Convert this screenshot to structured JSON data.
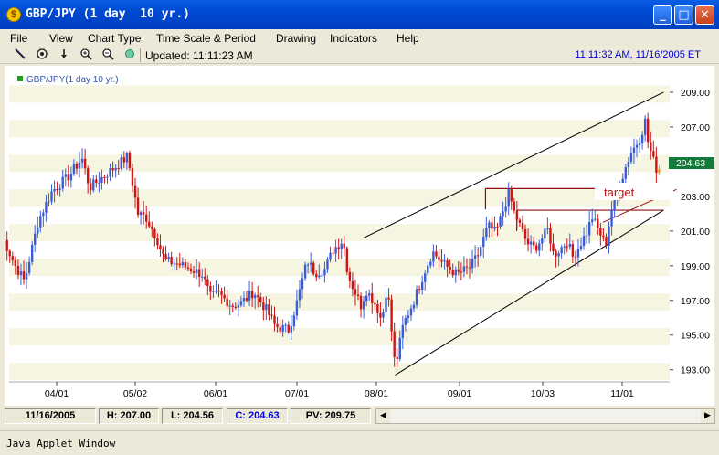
{
  "window": {
    "title": "GBP/JPY (1 day  10 yr.)",
    "minimize_glyph": "_",
    "maximize_glyph": "□",
    "close_glyph": "✕",
    "app_icon_glyph": "$"
  },
  "menu": [
    {
      "label": "File"
    },
    {
      "label": "View"
    },
    {
      "label": "Chart Type"
    },
    {
      "label": "Time Scale & Period"
    },
    {
      "label": "Drawing"
    },
    {
      "label": "Indicators"
    },
    {
      "label": "Help"
    }
  ],
  "toolbar": {
    "tools": [
      "line-tool-icon",
      "target-tool-icon",
      "down-arrow-icon",
      "zoom-in-icon",
      "zoom-out-icon",
      "refresh-icon"
    ],
    "updated": "Updated: 11:11:23 AM",
    "clock": "11:11:32 AM, 11/16/2005 ET"
  },
  "chart": {
    "legend": "GBP/JPY(1 day  10 yr.)",
    "target_label": "target",
    "last_price": "204.63"
  },
  "chart_data": {
    "type": "candlestick",
    "title": "GBP/JPY(1 day  10 yr.)",
    "symbol": "GBP/JPY",
    "ylim": [
      192.3,
      210.0
    ],
    "y_ticks": [
      "193.00",
      "195.00",
      "197.00",
      "199.00",
      "201.00",
      "203.00",
      "205.00",
      "207.00",
      "209.00"
    ],
    "x_ticks": [
      "04/01",
      "05/02",
      "06/01",
      "07/01",
      "08/01",
      "09/01",
      "10/03",
      "11/01"
    ],
    "grid": "alternating horizontal bands",
    "close_path": [
      [
        "03/08",
        200.8
      ],
      [
        "03/14",
        199.0
      ],
      [
        "03/18",
        198.1
      ],
      [
        "03/24",
        201.6
      ],
      [
        "03/30",
        203.3
      ],
      [
        "04/06",
        204.2
      ],
      [
        "04/11",
        205.2
      ],
      [
        "04/14",
        203.5
      ],
      [
        "04/19",
        204.1
      ],
      [
        "04/25",
        204.8
      ],
      [
        "04/29",
        205.3
      ],
      [
        "05/03",
        202.0
      ],
      [
        "05/06",
        201.8
      ],
      [
        "05/10",
        200.6
      ],
      [
        "05/13",
        199.3
      ],
      [
        "05/18",
        199.1
      ],
      [
        "05/23",
        198.8
      ],
      [
        "05/27",
        198.5
      ],
      [
        "05/30",
        197.2
      ],
      [
        "06/02",
        197.4
      ],
      [
        "06/07",
        196.7
      ],
      [
        "06/10",
        196.8
      ],
      [
        "06/15",
        197.5
      ],
      [
        "06/20",
        196.4
      ],
      [
        "06/23",
        195.5
      ],
      [
        "06/28",
        195.3
      ],
      [
        "07/01",
        196.9
      ],
      [
        "07/05",
        199.3
      ],
      [
        "07/08",
        198.6
      ],
      [
        "07/12",
        198.8
      ],
      [
        "07/15",
        199.9
      ],
      [
        "07/19",
        200.5
      ],
      [
        "07/21",
        198.4
      ],
      [
        "07/26",
        196.7
      ],
      [
        "07/28",
        197.6
      ],
      [
        "08/01",
        196.7
      ],
      [
        "08/03",
        195.8
      ],
      [
        "08/05",
        197.9
      ],
      [
        "08/08",
        193.1
      ],
      [
        "08/11",
        195.6
      ],
      [
        "08/15",
        197.0
      ],
      [
        "08/19",
        198.7
      ],
      [
        "08/22",
        199.8
      ],
      [
        "08/26",
        199.1
      ],
      [
        "08/31",
        198.5
      ],
      [
        "09/05",
        198.9
      ],
      [
        "09/08",
        199.6
      ],
      [
        "09/12",
        201.3
      ],
      [
        "09/15",
        200.9
      ],
      [
        "09/20",
        203.2
      ],
      [
        "09/22",
        202.1
      ],
      [
        "09/27",
        200.3
      ],
      [
        "09/30",
        200.0
      ],
      [
        "10/05",
        201.1
      ],
      [
        "10/07",
        199.6
      ],
      [
        "10/12",
        200.4
      ],
      [
        "10/14",
        199.5
      ],
      [
        "10/19",
        200.9
      ],
      [
        "10/21",
        201.8
      ],
      [
        "10/26",
        200.2
      ],
      [
        "10/28",
        202.2
      ],
      [
        "11/01",
        204.1
      ],
      [
        "11/04",
        205.4
      ],
      [
        "11/08",
        206.4
      ],
      [
        "11/10",
        207.4
      ],
      [
        "11/11",
        206.1
      ],
      [
        "11/14",
        204.6
      ],
      [
        "11/16",
        204.63
      ]
    ],
    "annotations": [
      {
        "type": "trend-line",
        "name": "upper channel",
        "from": [
          "07/27",
          200.6
        ],
        "to": [
          "11/17",
          209.0
        ]
      },
      {
        "type": "trend-line",
        "name": "lower channel",
        "from": [
          "08/08",
          192.7
        ],
        "to": [
          "11/17",
          202.2
        ]
      },
      {
        "type": "trend-line",
        "name": "red extension",
        "from": [
          "10/25",
          201.5
        ],
        "to": [
          "11/22",
          203.4
        ]
      },
      {
        "type": "level",
        "name": "upper resistance",
        "y": 203.45,
        "from": "09/11",
        "to": "11/17"
      },
      {
        "type": "level",
        "name": "target level",
        "y": 202.2,
        "from": "09/23",
        "to": "11/17"
      },
      {
        "type": "text",
        "label": "target",
        "at": [
          "11/04",
          202.9
        ]
      }
    ]
  },
  "status": {
    "date": "11/16/2005",
    "high": "H: 207.00",
    "low": "L: 204.56",
    "close": "C: 204.63",
    "pv": "PV: 209.75"
  },
  "footer": {
    "label": "Java Applet Window"
  },
  "colors": {
    "up": "#3a5dd6",
    "down": "#d01414",
    "title_bar": "#0a5ee6",
    "price_badge": "#147a3a",
    "current_candle": "#f0a020"
  }
}
